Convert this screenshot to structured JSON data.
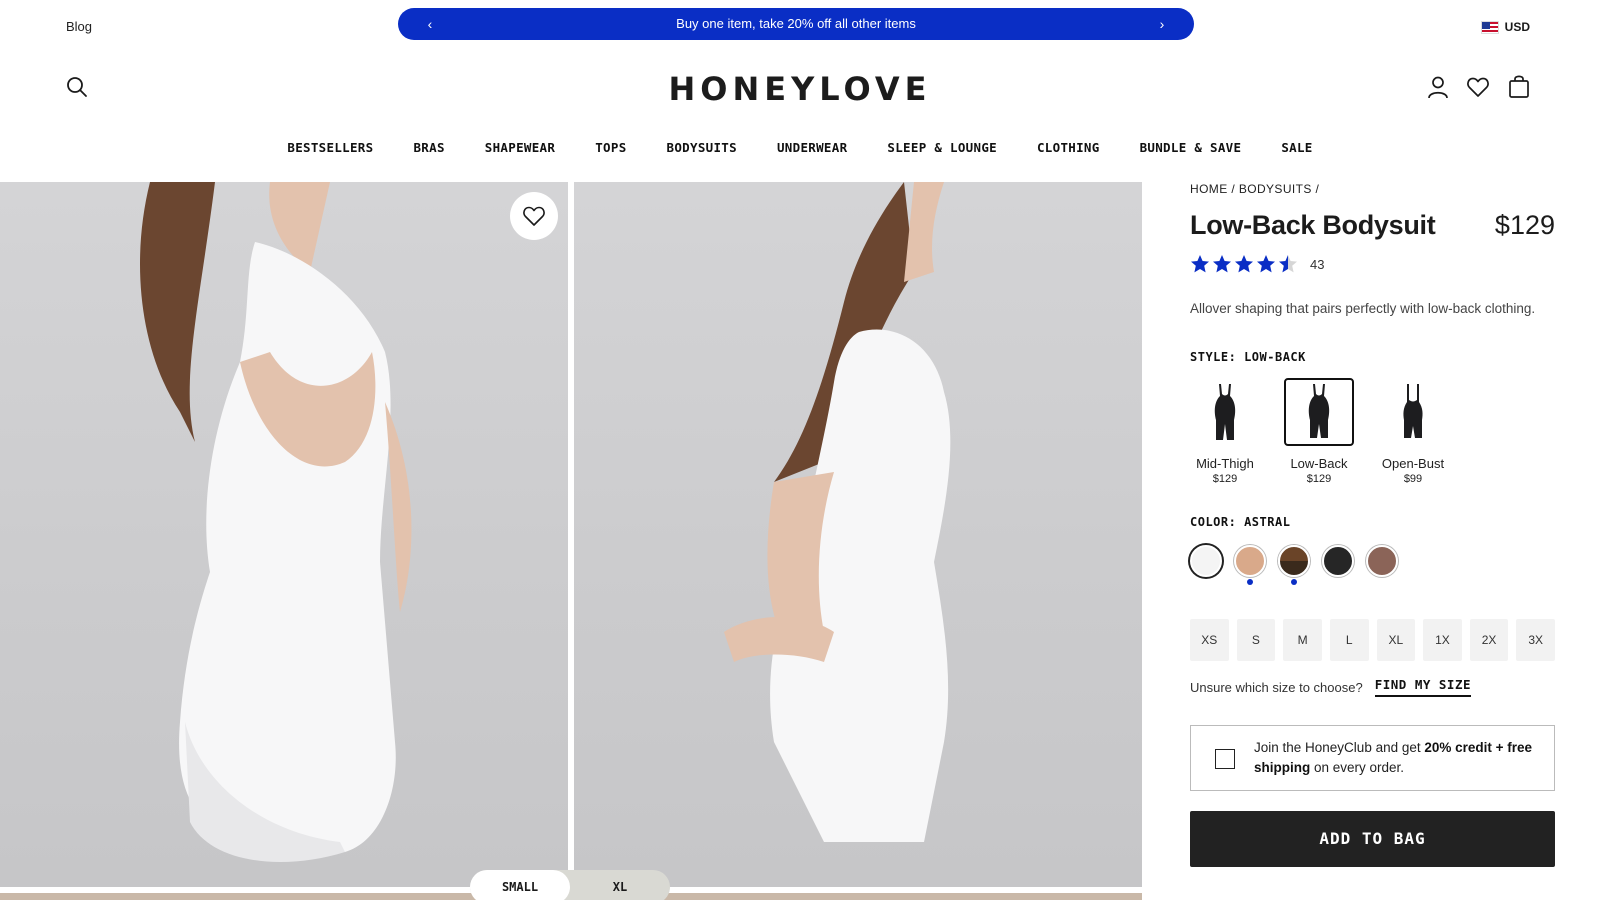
{
  "topbar": {
    "blog_label": "Blog",
    "promo_text": "Buy one item, take 20% off all other items",
    "prev_arrow": "‹",
    "next_arrow": "›",
    "currency": "USD"
  },
  "header": {
    "logo": "HONEYLOVE",
    "icons": [
      "search-icon",
      "account-icon",
      "wishlist-icon",
      "bag-icon"
    ]
  },
  "nav": {
    "items": [
      "BESTSELLERS",
      "BRAS",
      "SHAPEWEAR",
      "TOPS",
      "BODYSUITS",
      "UNDERWEAR",
      "SLEEP & LOUNGE",
      "CLOTHING",
      "BUNDLE & SAVE",
      "SALE"
    ]
  },
  "gallery": {
    "size_toggle": [
      "SMALL",
      "XL"
    ],
    "active_size_toggle": "SMALL"
  },
  "product": {
    "breadcrumb": [
      "HOME",
      "/",
      "BODYSUITS",
      "/"
    ],
    "title": "Low-Back Bodysuit",
    "price": "$129",
    "rating": 4.5,
    "review_count": "43",
    "description": "Allover shaping that pairs perfectly with low-back clothing.",
    "style_label": "STYLE: LOW-BACK",
    "styles": [
      {
        "name": "Mid-Thigh",
        "price": "$129"
      },
      {
        "name": "Low-Back",
        "price": "$129"
      },
      {
        "name": "Open-Bust",
        "price": "$99"
      }
    ],
    "active_style": "Low-Back",
    "color_label": "COLOR: ASTRAL",
    "colors": [
      {
        "hex": "#f4f4f4",
        "active": true,
        "dot": false
      },
      {
        "hex": "#d9a98a",
        "active": false,
        "dot": true
      },
      {
        "hex": "#5a3a22",
        "active": false,
        "dot": true
      },
      {
        "hex": "#262626",
        "active": false,
        "dot": false
      },
      {
        "hex": "#8b6458",
        "active": false,
        "dot": false
      }
    ],
    "sizes": [
      "XS",
      "S",
      "M",
      "L",
      "XL",
      "1X",
      "2X",
      "3X"
    ],
    "size_help_text": "Unsure which size to choose?",
    "find_size_label": "FIND MY SIZE",
    "club_text_1": "Join the HoneyClub and get ",
    "club_text_bold": "20% credit + free shipping",
    "club_text_2": " on every order.",
    "add_to_bag_label": "ADD TO BAG"
  },
  "colors": {
    "accent": "#0a2ec5",
    "button_dark": "#222222"
  }
}
